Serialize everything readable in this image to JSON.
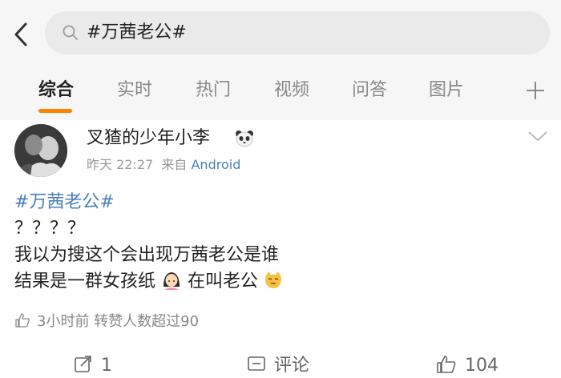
{
  "header": {
    "search_query": "#万茜老公#"
  },
  "tabs": [
    {
      "label": "综合",
      "active": true
    },
    {
      "label": "实时",
      "active": false
    },
    {
      "label": "热门",
      "active": false
    },
    {
      "label": "视频",
      "active": false
    },
    {
      "label": "问答",
      "active": false
    },
    {
      "label": "图片",
      "active": false
    }
  ],
  "post": {
    "username": "叉猹的少年小李",
    "username_emoji": "panda-icon",
    "time": "昨天 22:27",
    "source_prefix": "来自",
    "source": "Android",
    "hashtag": "#万茜老公#",
    "line2": "？？？？",
    "line3": "我以为搜这个会出现万茜老公是谁",
    "line4a": "结果是一群女孩纸",
    "line4b": "在叫老公",
    "likes_summary": "3小时前 转赞人数超过90"
  },
  "actions": {
    "repost": "1",
    "comment": "评论",
    "like": "104"
  },
  "colors": {
    "accent": "#ff8200",
    "link": "#4a7fb8",
    "header_bg": "#f6f6f6"
  }
}
